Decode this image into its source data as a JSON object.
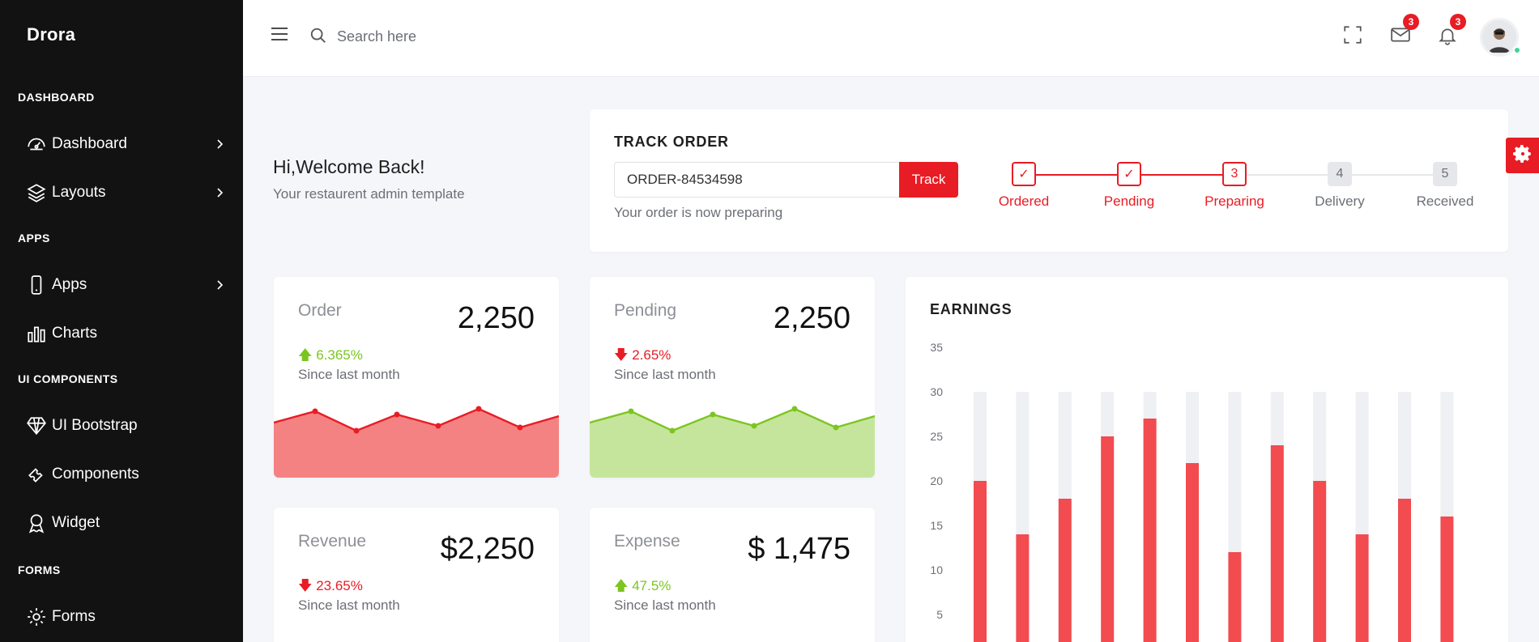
{
  "brand": {
    "name": "Drora"
  },
  "sidebar": {
    "sections": [
      {
        "title": "DASHBOARD"
      },
      {
        "title": "APPS"
      },
      {
        "title": "UI COMPONENTS"
      },
      {
        "title": "FORMS"
      }
    ],
    "items": [
      {
        "label": "Dashboard",
        "icon": "speedometer-icon",
        "has_children": true
      },
      {
        "label": "Layouts",
        "icon": "layers-icon",
        "has_children": true
      },
      {
        "label": "Apps",
        "icon": "mobile-icon",
        "has_children": true
      },
      {
        "label": "Charts",
        "icon": "bar-chart-icon",
        "has_children": false
      },
      {
        "label": "UI Bootstrap",
        "icon": "diamond-icon",
        "has_children": false
      },
      {
        "label": "Components",
        "icon": "puzzle-icon",
        "has_children": false
      },
      {
        "label": "Widget",
        "icon": "award-icon",
        "has_children": false
      },
      {
        "label": "Forms",
        "icon": "gear-icon",
        "has_children": false
      }
    ]
  },
  "header": {
    "search_placeholder": "Search here",
    "mail_count": "3",
    "notification_count": "3"
  },
  "welcome": {
    "title": "Hi,Welcome Back!",
    "subtitle": "Your restaurent admin template"
  },
  "track_order": {
    "title": "TRACK ORDER",
    "order_id": "ORDER-84534598",
    "button_label": "Track",
    "status_text": "Your order is now preparing",
    "steps": [
      {
        "marker": "✓",
        "label": "Ordered",
        "state": "done"
      },
      {
        "marker": "✓",
        "label": "Pending",
        "state": "done"
      },
      {
        "marker": "3",
        "label": "Preparing",
        "state": "current"
      },
      {
        "marker": "4",
        "label": "Delivery",
        "state": "todo"
      },
      {
        "marker": "5",
        "label": "Received",
        "state": "todo"
      }
    ]
  },
  "stats": [
    {
      "label": "Order",
      "value": "2,250",
      "change": "6.365%",
      "direction": "up",
      "since": "Since last month"
    },
    {
      "label": "Pending",
      "value": "2,250",
      "change": "2.65%",
      "direction": "down",
      "since": "Since last month"
    },
    {
      "label": "Revenue",
      "value": "$2,250",
      "change": "23.65%",
      "direction": "down",
      "since": "Since last month"
    },
    {
      "label": "Expense",
      "value": "$ 1,475",
      "change": "47.5%",
      "direction": "up",
      "since": "Since last month"
    }
  ],
  "colors": {
    "accent": "#e81c24",
    "up": "#7cc520",
    "down": "#e81c24",
    "order_fill": "#f58282",
    "pending_fill": "#c6e59c",
    "bar": "#f24b50",
    "bar_track": "#eef0f4"
  },
  "earnings": {
    "title": "EARNINGS"
  },
  "chart_data": {
    "type": "bar",
    "title": "EARNINGS",
    "values": [
      20,
      14,
      18,
      25,
      27,
      22,
      12,
      24,
      20,
      14,
      18,
      16
    ],
    "background_max": 30,
    "yticks": [
      5,
      10,
      15,
      20,
      25,
      30,
      35
    ],
    "ylim": [
      0,
      35
    ],
    "grid": false
  }
}
